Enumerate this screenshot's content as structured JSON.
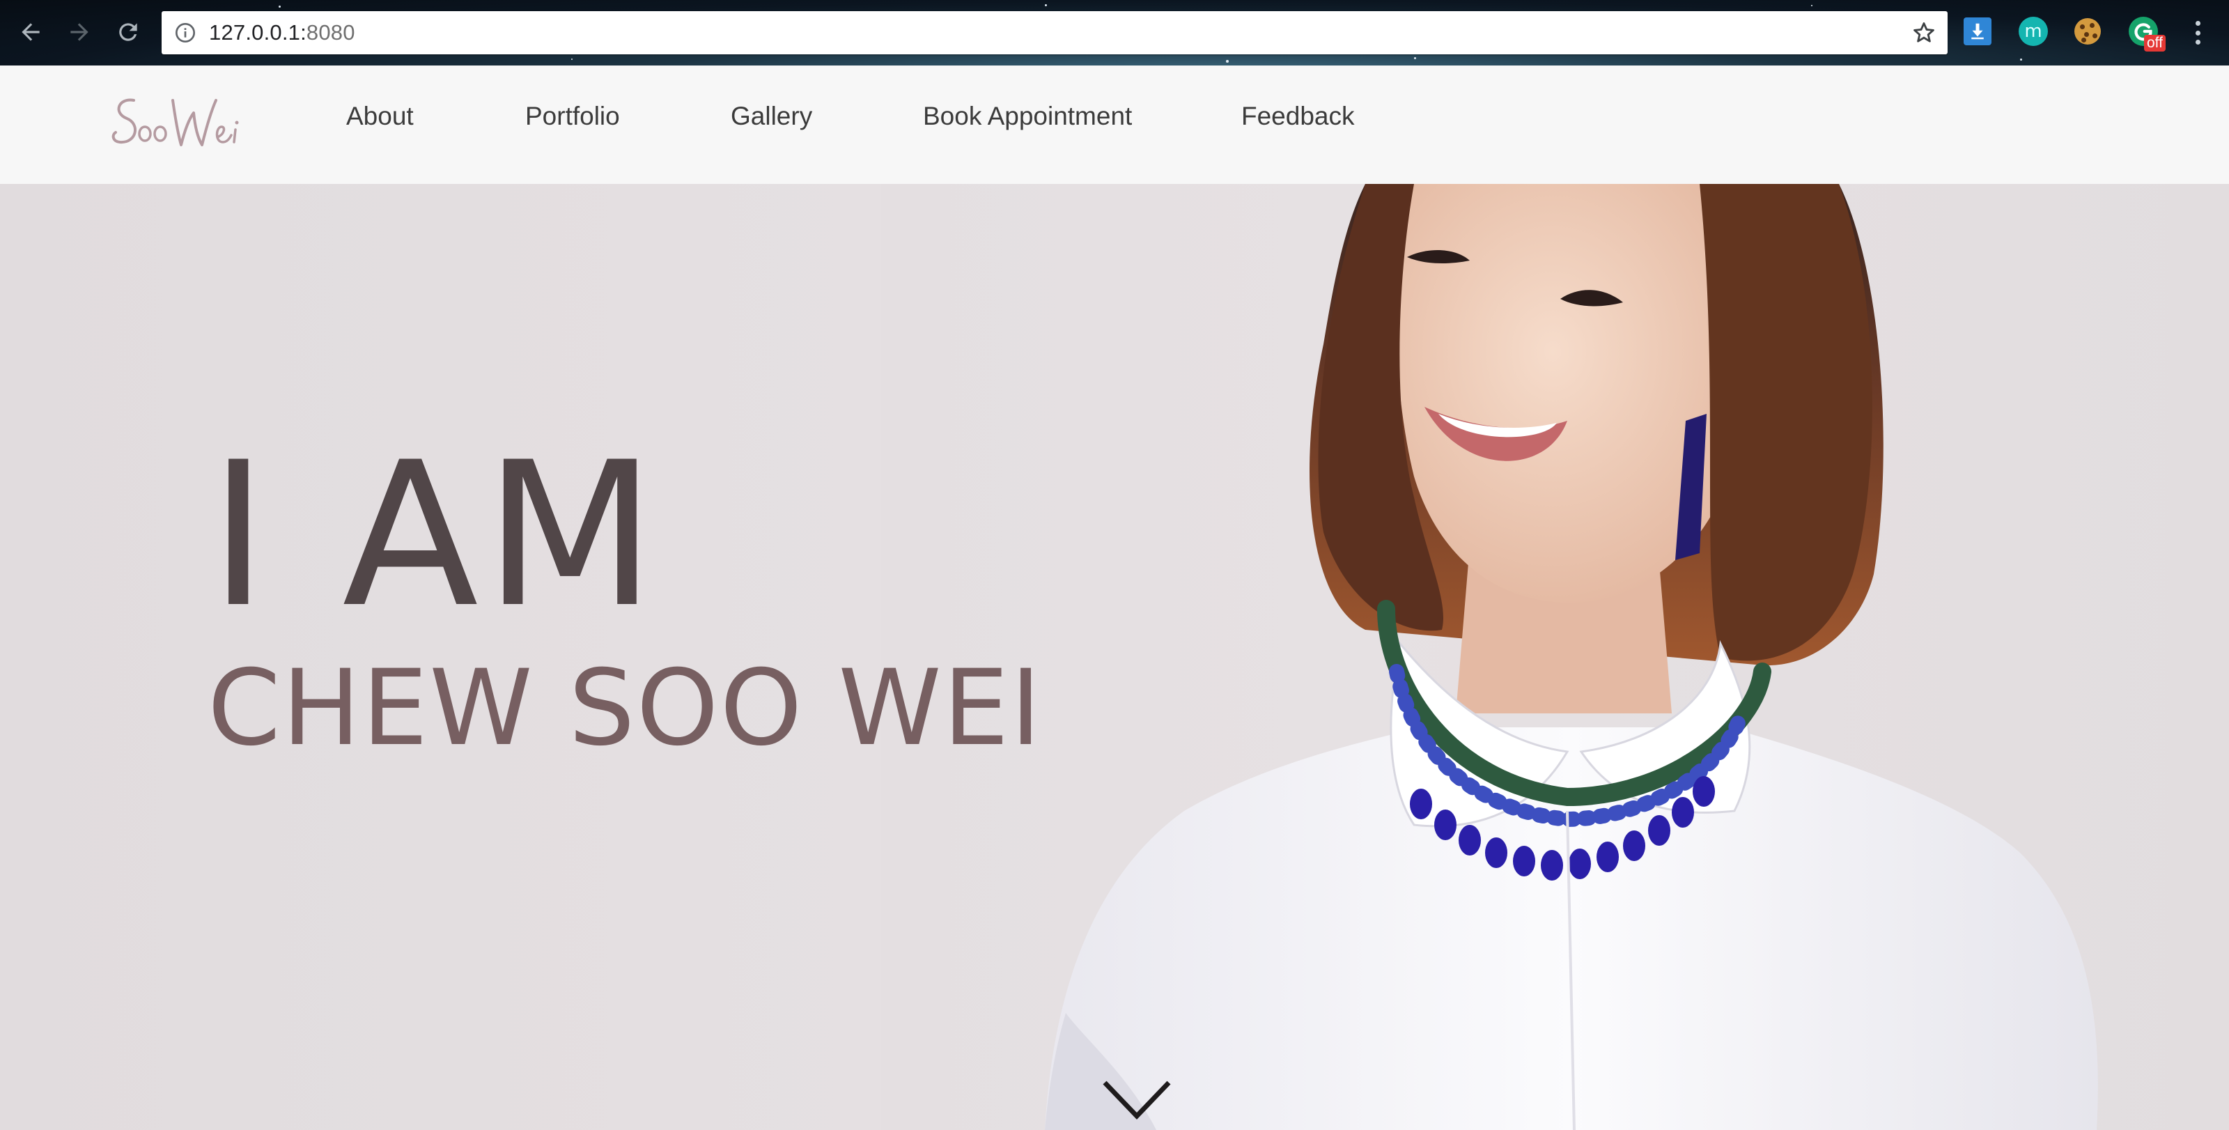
{
  "browser": {
    "url_host": "127.0.0.1:",
    "url_port": "8080",
    "extensions": [
      {
        "name": "download-extension",
        "icon": "download-icon",
        "color": "#2f86d6"
      },
      {
        "name": "m-extension",
        "icon": "m-letter-icon",
        "label": "m",
        "color": "#14b5b0"
      },
      {
        "name": "cookie-extension",
        "icon": "cookie-icon",
        "color": "#d49a3e"
      },
      {
        "name": "grammarly-extension",
        "icon": "grammarly-icon",
        "badge": "off",
        "color": "#15a36a"
      }
    ]
  },
  "header": {
    "logo_text": "Soo Wei",
    "nav": [
      {
        "label": "About"
      },
      {
        "label": "Portfolio"
      },
      {
        "label": "Gallery"
      },
      {
        "label": "Book Appointment"
      },
      {
        "label": "Feedback"
      }
    ]
  },
  "hero": {
    "line1": "I AM",
    "line2": "CHEW SOO WEI",
    "scroll_icon": "chevron-down-icon"
  },
  "colors": {
    "heading_dark": "#514648",
    "heading_name": "#775f61",
    "header_bg": "#f7f7f7",
    "logo": "#b49aa0"
  }
}
